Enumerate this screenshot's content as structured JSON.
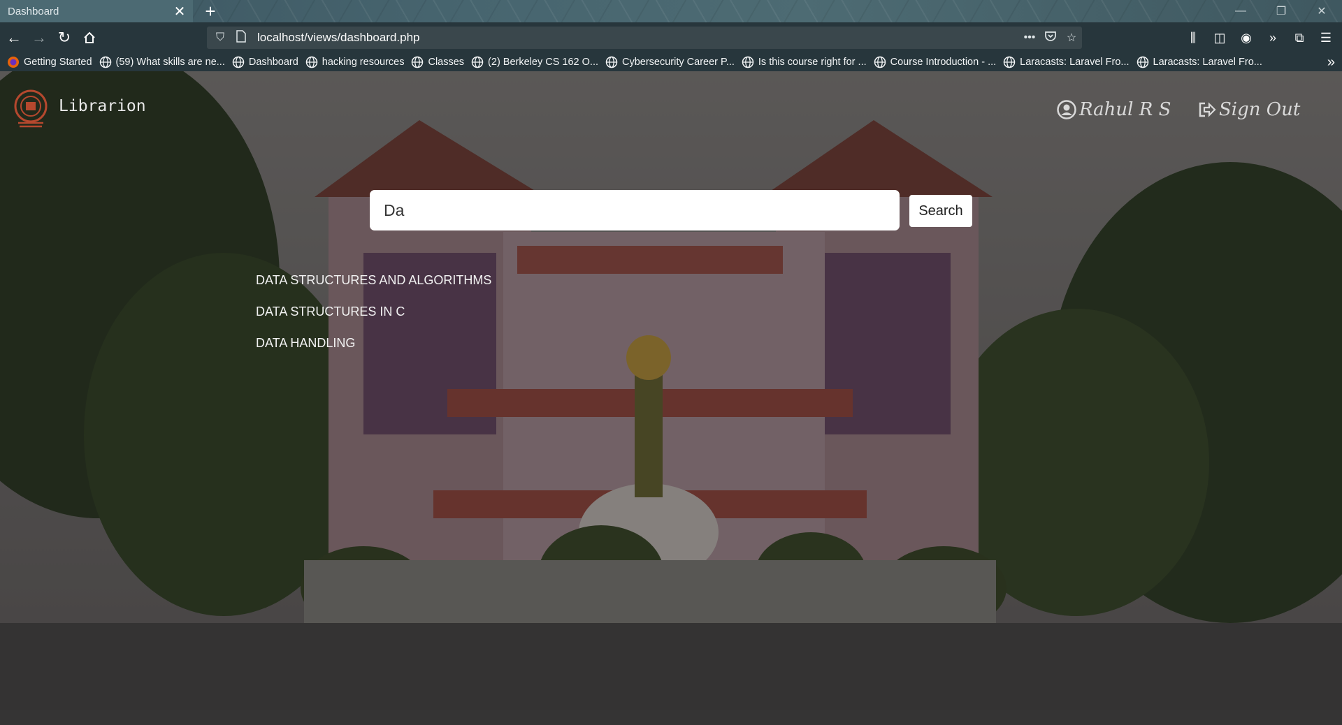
{
  "browser": {
    "tab_title": "Dashboard",
    "tab_close": "✕",
    "new_tab": "+",
    "url": "localhost/views/dashboard.php",
    "url_more": "•••",
    "bookmarks": [
      "Getting Started",
      "(59) What skills are ne...",
      "Dashboard",
      "hacking resources",
      "Classes",
      "(2) Berkeley CS 162 O...",
      "Cybersecurity Career P...",
      "Is this course right for ...",
      "Course Introduction - ...",
      "Laracasts: Laravel Fro...",
      "Laracasts: Laravel Fro..."
    ]
  },
  "header": {
    "brand": "Librarion",
    "user": "Rahul R S",
    "signout": "Sign Out"
  },
  "search": {
    "value": "Da",
    "button": "Search"
  },
  "results": [
    "DATA STRUCTURES AND ALGORITHMS",
    "DATA STRUCTURES IN C",
    "DATA HANDLING"
  ],
  "colors": {
    "chrome_dark": "#27363c",
    "tabbar": "#47656f",
    "overlay": "rgba(20,20,22,0.42)"
  }
}
